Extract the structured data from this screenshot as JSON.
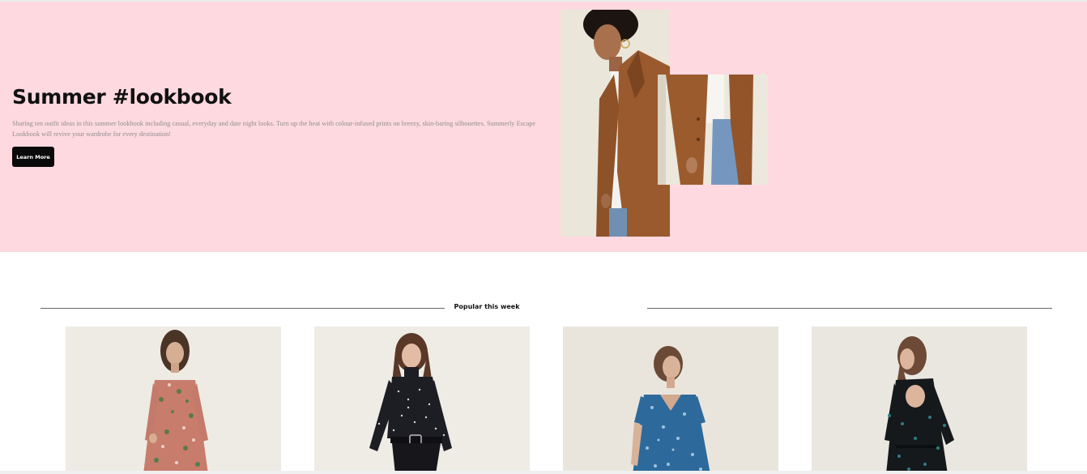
{
  "hero": {
    "title": "Summer #lookbook",
    "description": "Sharing ten outfit ideas in this summer lookbook including casual, everyday and date night looks. Turn up the heat with colour-infused prints on breezy, skin-baring silhouettes. Summerly Escape Lookbook will revive your wardrobe for every destination!",
    "button_label": "Learn More",
    "background_color": "#ffd9e0"
  },
  "hero_images": [
    {
      "name": "hero-image-coat-model"
    },
    {
      "name": "hero-image-coat-detail"
    }
  ],
  "popular": {
    "heading": "Popular this week",
    "products": [
      {
        "name": "product-floral-dress"
      },
      {
        "name": "product-polka-dot-blouse"
      },
      {
        "name": "product-blue-print-dress"
      },
      {
        "name": "product-black-backless-dress"
      }
    ]
  }
}
